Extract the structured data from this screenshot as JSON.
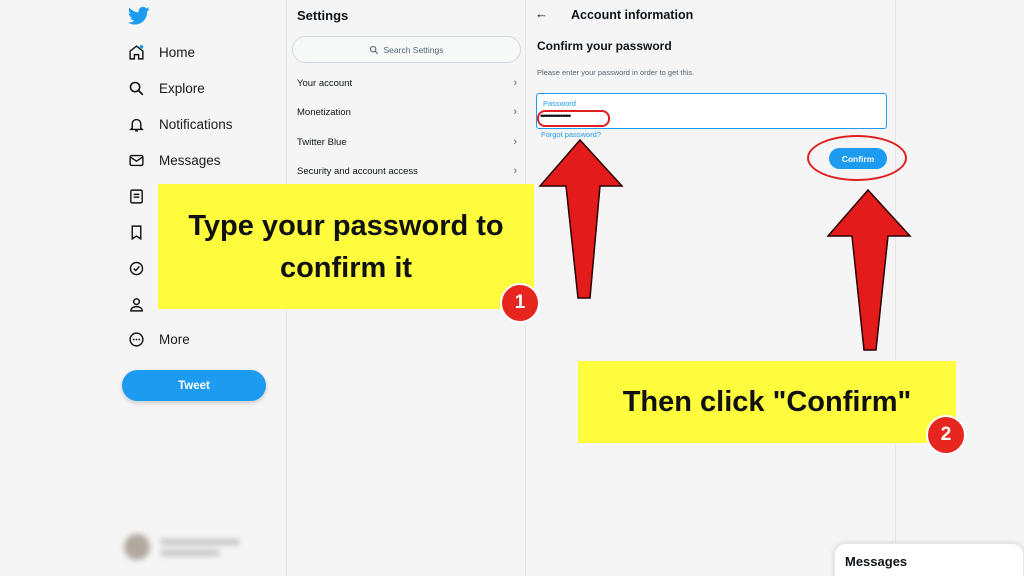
{
  "nav": {
    "logo_icon": "twitter-bird-icon",
    "items": [
      {
        "label": "Home",
        "icon": "home-icon"
      },
      {
        "label": "Explore",
        "icon": "search-icon"
      },
      {
        "label": "Notifications",
        "icon": "bell-icon"
      },
      {
        "label": "Messages",
        "icon": "mail-icon"
      },
      {
        "label": "",
        "icon": "lists-icon"
      },
      {
        "label": "",
        "icon": "bookmark-icon"
      },
      {
        "label": "",
        "icon": "verified-icon"
      },
      {
        "label": "",
        "icon": "profile-icon"
      },
      {
        "label": "More",
        "icon": "more-circle-icon"
      }
    ],
    "tweet_label": "Tweet"
  },
  "settings": {
    "title": "Settings",
    "search_placeholder": "Search Settings",
    "items": [
      {
        "label": "Your account"
      },
      {
        "label": "Monetization"
      },
      {
        "label": "Twitter Blue"
      },
      {
        "label": "Security and account access"
      }
    ]
  },
  "account": {
    "title": "Account information",
    "subtitle": "Confirm your password",
    "help_text": "Please enter your password in order to get this.",
    "password_label": "Password",
    "password_value": "••••••••••••••••••",
    "forgot_label": "Forgot password?",
    "confirm_label": "Confirm"
  },
  "annotations": {
    "step1_text": "Type your password to confirm it",
    "step1_badge": "1",
    "step2_text": "Then click \"Confirm\"",
    "step2_badge": "2",
    "arrow_color": "#e31b1b",
    "highlight_color": "#fffb3d"
  },
  "drawer": {
    "title": "Messages"
  },
  "colors": {
    "accent": "#1d9bf0",
    "annotation_red": "#e02020"
  }
}
